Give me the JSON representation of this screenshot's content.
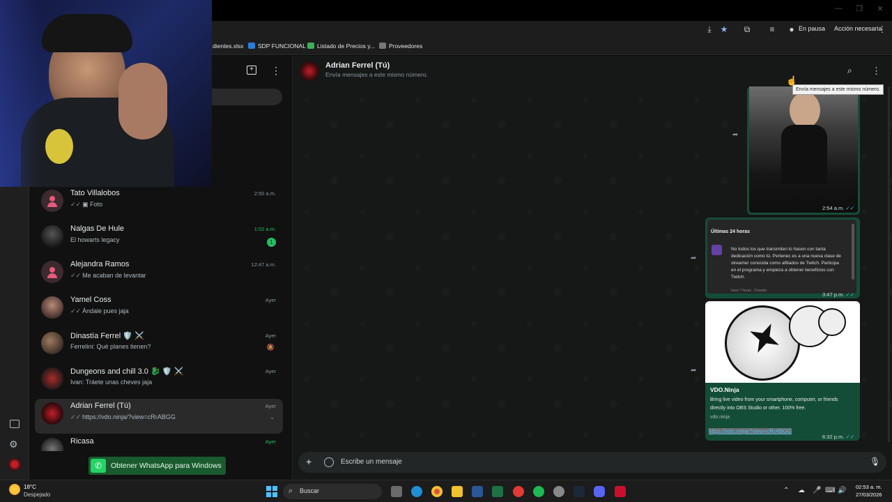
{
  "browser": {
    "status_label": "En pausa",
    "action_label": "Acción necesaria",
    "bookmarks": [
      {
        "label": "dientes.xlsx"
      },
      {
        "label": "SDP FUNCIONAL"
      },
      {
        "label": "Listado de Precios y..."
      },
      {
        "label": "Proveedores"
      }
    ]
  },
  "sidebar": {
    "chats": [
      {
        "name": "Tato Villalobos",
        "preview": "Foto",
        "time": "2:50 a.m.",
        "avatar": "default"
      },
      {
        "name": "Nalgas De Hule",
        "preview": "El howarts legacy",
        "time": "1:02 a.m.",
        "unread": "1",
        "avatar": "photo"
      },
      {
        "name": "Alejandra Ramos",
        "preview": "Me acaban de levantar",
        "time": "12:47 a.m.",
        "avatar": "default"
      },
      {
        "name": "Yamel  Coss",
        "preview": "Ándale pues jaja",
        "time": "Ayer",
        "avatar": "photo"
      },
      {
        "name": "Dinastía Ferrel 🛡️ ⚔️",
        "preview": "Ferrelini: Qué planes tienen?",
        "time": "Ayer",
        "avatar": "photo"
      },
      {
        "name": "Dungeons and chill 3.0 🐉 🛡️ ⚔️",
        "preview": "Ivan: Tráete unas cheves jaja",
        "time": "Ayer",
        "avatar": "photo"
      },
      {
        "name": "Adrian Ferrel (Tú)",
        "preview": "https://vdo.ninja/?view=cRrABGG",
        "time": "Ayer",
        "avatar": "photo"
      },
      {
        "name": "Ricasa",
        "preview": "",
        "time": "Ayer",
        "avatar": "photo"
      }
    ],
    "get_app_label": "Obtener WhatsApp para Windows"
  },
  "chat": {
    "title": "Adrian Ferrel (Tú)",
    "subtitle": "Envía mensajes a este mismo número.",
    "tooltip": "Envía mensajes a este mismo número.",
    "messages": [
      {
        "type": "image",
        "time": "2:54 a.m."
      },
      {
        "type": "card",
        "card_title": "Últimas 24 horas",
        "card_body": "No todos los que transmiten lo hacen con tanta dedicación como tú. Pertenec es a una nueva clase de streamer conocida como afiliados de Twitch. Participa en el programa y empieza a obtener beneficios con Twitch.",
        "card_footer": "hace 7 horas · Creador",
        "time": "3:47 p.m."
      },
      {
        "type": "link",
        "link_title": "VDO.Ninja",
        "link_desc": "Bring live video from your smartphone, computer, or friends directly into OBS Studio or other. 100% free.",
        "link_domain": "vdo.ninja",
        "url": "https://vdo.ninja/?view=cRrABGG",
        "time": "6:32 p.m."
      }
    ],
    "composer_placeholder": "Escribe un mensaje"
  },
  "taskbar": {
    "weather_temp": "18°C",
    "weather_desc": "Despejado",
    "search_label": "Buscar",
    "time": "02:53 a. m.",
    "date": "27/03/2026"
  },
  "colors": {
    "accent": "#21c063",
    "bubble": "#144d37",
    "background": "#161717"
  }
}
